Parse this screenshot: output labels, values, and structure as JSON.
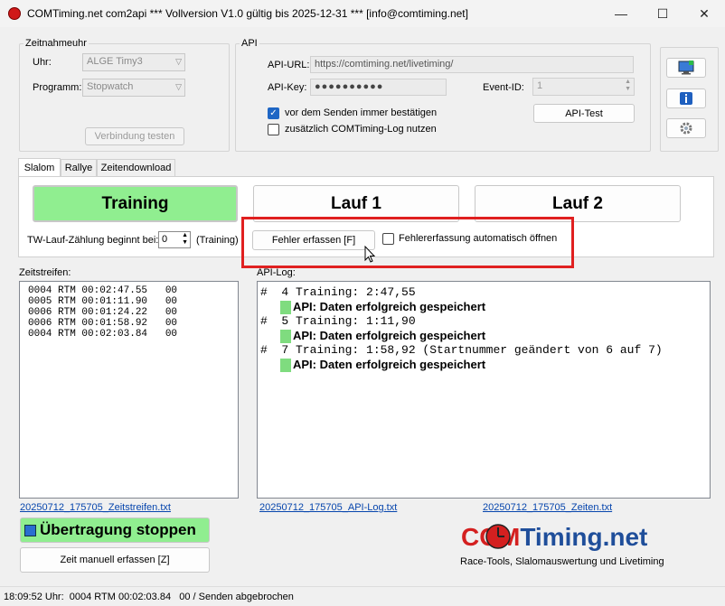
{
  "window": {
    "title": "COMTiming.net com2api *** Vollversion V1.0 gültig bis 2025-12-31 *** [info@comtiming.net]",
    "minimize": "—",
    "maximize": "☐",
    "close": "✕"
  },
  "zeitnahme": {
    "legend": "Zeitnahmeuhr",
    "uhr_label": "Uhr:",
    "uhr_value": "ALGE Timy3",
    "programm_label": "Programm:",
    "programm_value": "Stopwatch",
    "test_button": "Verbindung testen"
  },
  "api": {
    "legend": "API",
    "url_label": "API-URL:",
    "url_value": "https://comtiming.net/livetiming/",
    "key_label": "API-Key:",
    "key_value": "●●●●●●●●●●",
    "event_label": "Event-ID:",
    "event_value": "1",
    "confirm_label": "vor dem Senden immer bestätigen",
    "confirm_checked": true,
    "log_label": "zusätzlich COMTiming-Log nutzen",
    "log_checked": false,
    "test_button": "API-Test"
  },
  "tabs": [
    "Slalom",
    "Rallye",
    "Zeitendownload"
  ],
  "slalom": {
    "training_button": "Training",
    "lauf1_button": "Lauf 1",
    "lauf2_button": "Lauf 2",
    "tw_label": "TW-Lauf-Zählung beginnt bei:",
    "tw_value": "0",
    "tw_suffix": "(Training)",
    "fehler_button": "Fehler erfassen [F]",
    "fehler_auto_label": "Fehlererfassung automatisch öffnen"
  },
  "zeitstreifen": {
    "label": "Zeitstreifen:",
    "rows": [
      "0004 RTM 00:02:47.55   00",
      "0005 RTM 00:01:11.90   00",
      "0006 RTM 00:01:24.22   00",
      "0006 RTM 00:01:58.92   00",
      "0004 RTM 00:02:03.84   00"
    ],
    "file_link": "20250712_175705_Zeitstreifen.txt"
  },
  "apilog": {
    "label": "API-Log:",
    "entries": [
      {
        "type": "line",
        "text": "#  4 Training: 2:47,55"
      },
      {
        "type": "ok",
        "text": "API: Daten erfolgreich gespeichert"
      },
      {
        "type": "line",
        "text": "#  5 Training: 1:11,90"
      },
      {
        "type": "ok",
        "text": "API: Daten erfolgreich gespeichert"
      },
      {
        "type": "line",
        "text": "#  7 Training: 1:58,92 (Startnummer geändert von 6 auf 7)"
      },
      {
        "type": "ok",
        "text": "API: Daten erfolgreich gespeichert"
      }
    ],
    "file_link": "20250712_175705_API-Log.txt",
    "zeiten_link": "20250712_175705_Zeiten.txt"
  },
  "bottom": {
    "stop_button": "Übertragung stoppen",
    "manual_button": "Zeit manuell erfassen [Z]"
  },
  "logo": {
    "com": "COM",
    "rest": "Timing.net",
    "tagline": "Race-Tools, Slalomauswertung und Livetiming"
  },
  "status": {
    "text": "18:09:52 Uhr:  0004 RTM 00:02:03.84   00 / Senden abgebrochen"
  },
  "colors": {
    "green": "#90ee90",
    "highlight": "#e02020",
    "logo_red": "#d42020",
    "logo_blue": "#1f4e9a"
  }
}
